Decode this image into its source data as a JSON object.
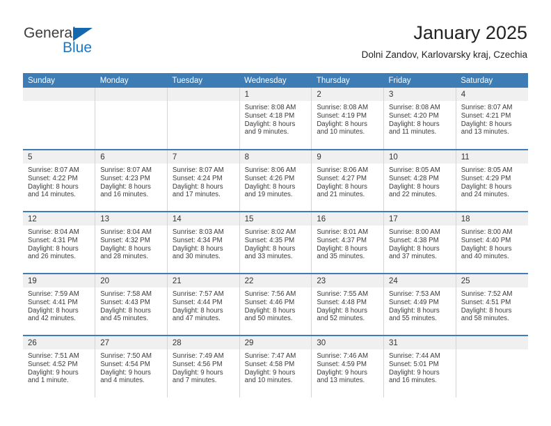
{
  "logo": {
    "word_one": "General",
    "word_two": "Blue",
    "triangle_icon": "blue-triangle-icon",
    "primary_color": "#1567ae",
    "text_color": "#3c3c3c"
  },
  "header": {
    "title": "January 2025",
    "subtitle": "Dolni Zandov, Karlovarsky kraj, Czechia"
  },
  "theme": {
    "header_row_bg": "#3d7cb5",
    "daynum_bg": "#f0f0f0",
    "cell_border": "#d4d4d4",
    "text": "#3a3a3a"
  },
  "weekday_headers": [
    "Sunday",
    "Monday",
    "Tuesday",
    "Wednesday",
    "Thursday",
    "Friday",
    "Saturday"
  ],
  "weeks": [
    [
      {
        "day": "",
        "sunrise": "",
        "sunset": "",
        "daylight_line1": "",
        "daylight_line2": "",
        "empty": true
      },
      {
        "day": "",
        "sunrise": "",
        "sunset": "",
        "daylight_line1": "",
        "daylight_line2": "",
        "empty": true
      },
      {
        "day": "",
        "sunrise": "",
        "sunset": "",
        "daylight_line1": "",
        "daylight_line2": "",
        "empty": true
      },
      {
        "day": "1",
        "sunrise": "Sunrise: 8:08 AM",
        "sunset": "Sunset: 4:18 PM",
        "daylight_line1": "Daylight: 8 hours",
        "daylight_line2": "and 9 minutes.",
        "empty": false
      },
      {
        "day": "2",
        "sunrise": "Sunrise: 8:08 AM",
        "sunset": "Sunset: 4:19 PM",
        "daylight_line1": "Daylight: 8 hours",
        "daylight_line2": "and 10 minutes.",
        "empty": false
      },
      {
        "day": "3",
        "sunrise": "Sunrise: 8:08 AM",
        "sunset": "Sunset: 4:20 PM",
        "daylight_line1": "Daylight: 8 hours",
        "daylight_line2": "and 11 minutes.",
        "empty": false
      },
      {
        "day": "4",
        "sunrise": "Sunrise: 8:07 AM",
        "sunset": "Sunset: 4:21 PM",
        "daylight_line1": "Daylight: 8 hours",
        "daylight_line2": "and 13 minutes.",
        "empty": false
      }
    ],
    [
      {
        "day": "5",
        "sunrise": "Sunrise: 8:07 AM",
        "sunset": "Sunset: 4:22 PM",
        "daylight_line1": "Daylight: 8 hours",
        "daylight_line2": "and 14 minutes.",
        "empty": false
      },
      {
        "day": "6",
        "sunrise": "Sunrise: 8:07 AM",
        "sunset": "Sunset: 4:23 PM",
        "daylight_line1": "Daylight: 8 hours",
        "daylight_line2": "and 16 minutes.",
        "empty": false
      },
      {
        "day": "7",
        "sunrise": "Sunrise: 8:07 AM",
        "sunset": "Sunset: 4:24 PM",
        "daylight_line1": "Daylight: 8 hours",
        "daylight_line2": "and 17 minutes.",
        "empty": false
      },
      {
        "day": "8",
        "sunrise": "Sunrise: 8:06 AM",
        "sunset": "Sunset: 4:26 PM",
        "daylight_line1": "Daylight: 8 hours",
        "daylight_line2": "and 19 minutes.",
        "empty": false
      },
      {
        "day": "9",
        "sunrise": "Sunrise: 8:06 AM",
        "sunset": "Sunset: 4:27 PM",
        "daylight_line1": "Daylight: 8 hours",
        "daylight_line2": "and 21 minutes.",
        "empty": false
      },
      {
        "day": "10",
        "sunrise": "Sunrise: 8:05 AM",
        "sunset": "Sunset: 4:28 PM",
        "daylight_line1": "Daylight: 8 hours",
        "daylight_line2": "and 22 minutes.",
        "empty": false
      },
      {
        "day": "11",
        "sunrise": "Sunrise: 8:05 AM",
        "sunset": "Sunset: 4:29 PM",
        "daylight_line1": "Daylight: 8 hours",
        "daylight_line2": "and 24 minutes.",
        "empty": false
      }
    ],
    [
      {
        "day": "12",
        "sunrise": "Sunrise: 8:04 AM",
        "sunset": "Sunset: 4:31 PM",
        "daylight_line1": "Daylight: 8 hours",
        "daylight_line2": "and 26 minutes.",
        "empty": false
      },
      {
        "day": "13",
        "sunrise": "Sunrise: 8:04 AM",
        "sunset": "Sunset: 4:32 PM",
        "daylight_line1": "Daylight: 8 hours",
        "daylight_line2": "and 28 minutes.",
        "empty": false
      },
      {
        "day": "14",
        "sunrise": "Sunrise: 8:03 AM",
        "sunset": "Sunset: 4:34 PM",
        "daylight_line1": "Daylight: 8 hours",
        "daylight_line2": "and 30 minutes.",
        "empty": false
      },
      {
        "day": "15",
        "sunrise": "Sunrise: 8:02 AM",
        "sunset": "Sunset: 4:35 PM",
        "daylight_line1": "Daylight: 8 hours",
        "daylight_line2": "and 33 minutes.",
        "empty": false
      },
      {
        "day": "16",
        "sunrise": "Sunrise: 8:01 AM",
        "sunset": "Sunset: 4:37 PM",
        "daylight_line1": "Daylight: 8 hours",
        "daylight_line2": "and 35 minutes.",
        "empty": false
      },
      {
        "day": "17",
        "sunrise": "Sunrise: 8:00 AM",
        "sunset": "Sunset: 4:38 PM",
        "daylight_line1": "Daylight: 8 hours",
        "daylight_line2": "and 37 minutes.",
        "empty": false
      },
      {
        "day": "18",
        "sunrise": "Sunrise: 8:00 AM",
        "sunset": "Sunset: 4:40 PM",
        "daylight_line1": "Daylight: 8 hours",
        "daylight_line2": "and 40 minutes.",
        "empty": false
      }
    ],
    [
      {
        "day": "19",
        "sunrise": "Sunrise: 7:59 AM",
        "sunset": "Sunset: 4:41 PM",
        "daylight_line1": "Daylight: 8 hours",
        "daylight_line2": "and 42 minutes.",
        "empty": false
      },
      {
        "day": "20",
        "sunrise": "Sunrise: 7:58 AM",
        "sunset": "Sunset: 4:43 PM",
        "daylight_line1": "Daylight: 8 hours",
        "daylight_line2": "and 45 minutes.",
        "empty": false
      },
      {
        "day": "21",
        "sunrise": "Sunrise: 7:57 AM",
        "sunset": "Sunset: 4:44 PM",
        "daylight_line1": "Daylight: 8 hours",
        "daylight_line2": "and 47 minutes.",
        "empty": false
      },
      {
        "day": "22",
        "sunrise": "Sunrise: 7:56 AM",
        "sunset": "Sunset: 4:46 PM",
        "daylight_line1": "Daylight: 8 hours",
        "daylight_line2": "and 50 minutes.",
        "empty": false
      },
      {
        "day": "23",
        "sunrise": "Sunrise: 7:55 AM",
        "sunset": "Sunset: 4:48 PM",
        "daylight_line1": "Daylight: 8 hours",
        "daylight_line2": "and 52 minutes.",
        "empty": false
      },
      {
        "day": "24",
        "sunrise": "Sunrise: 7:53 AM",
        "sunset": "Sunset: 4:49 PM",
        "daylight_line1": "Daylight: 8 hours",
        "daylight_line2": "and 55 minutes.",
        "empty": false
      },
      {
        "day": "25",
        "sunrise": "Sunrise: 7:52 AM",
        "sunset": "Sunset: 4:51 PM",
        "daylight_line1": "Daylight: 8 hours",
        "daylight_line2": "and 58 minutes.",
        "empty": false
      }
    ],
    [
      {
        "day": "26",
        "sunrise": "Sunrise: 7:51 AM",
        "sunset": "Sunset: 4:52 PM",
        "daylight_line1": "Daylight: 9 hours",
        "daylight_line2": "and 1 minute.",
        "empty": false
      },
      {
        "day": "27",
        "sunrise": "Sunrise: 7:50 AM",
        "sunset": "Sunset: 4:54 PM",
        "daylight_line1": "Daylight: 9 hours",
        "daylight_line2": "and 4 minutes.",
        "empty": false
      },
      {
        "day": "28",
        "sunrise": "Sunrise: 7:49 AM",
        "sunset": "Sunset: 4:56 PM",
        "daylight_line1": "Daylight: 9 hours",
        "daylight_line2": "and 7 minutes.",
        "empty": false
      },
      {
        "day": "29",
        "sunrise": "Sunrise: 7:47 AM",
        "sunset": "Sunset: 4:58 PM",
        "daylight_line1": "Daylight: 9 hours",
        "daylight_line2": "and 10 minutes.",
        "empty": false
      },
      {
        "day": "30",
        "sunrise": "Sunrise: 7:46 AM",
        "sunset": "Sunset: 4:59 PM",
        "daylight_line1": "Daylight: 9 hours",
        "daylight_line2": "and 13 minutes.",
        "empty": false
      },
      {
        "day": "31",
        "sunrise": "Sunrise: 7:44 AM",
        "sunset": "Sunset: 5:01 PM",
        "daylight_line1": "Daylight: 9 hours",
        "daylight_line2": "and 16 minutes.",
        "empty": false
      },
      {
        "day": "",
        "sunrise": "",
        "sunset": "",
        "daylight_line1": "",
        "daylight_line2": "",
        "empty": true
      }
    ]
  ]
}
